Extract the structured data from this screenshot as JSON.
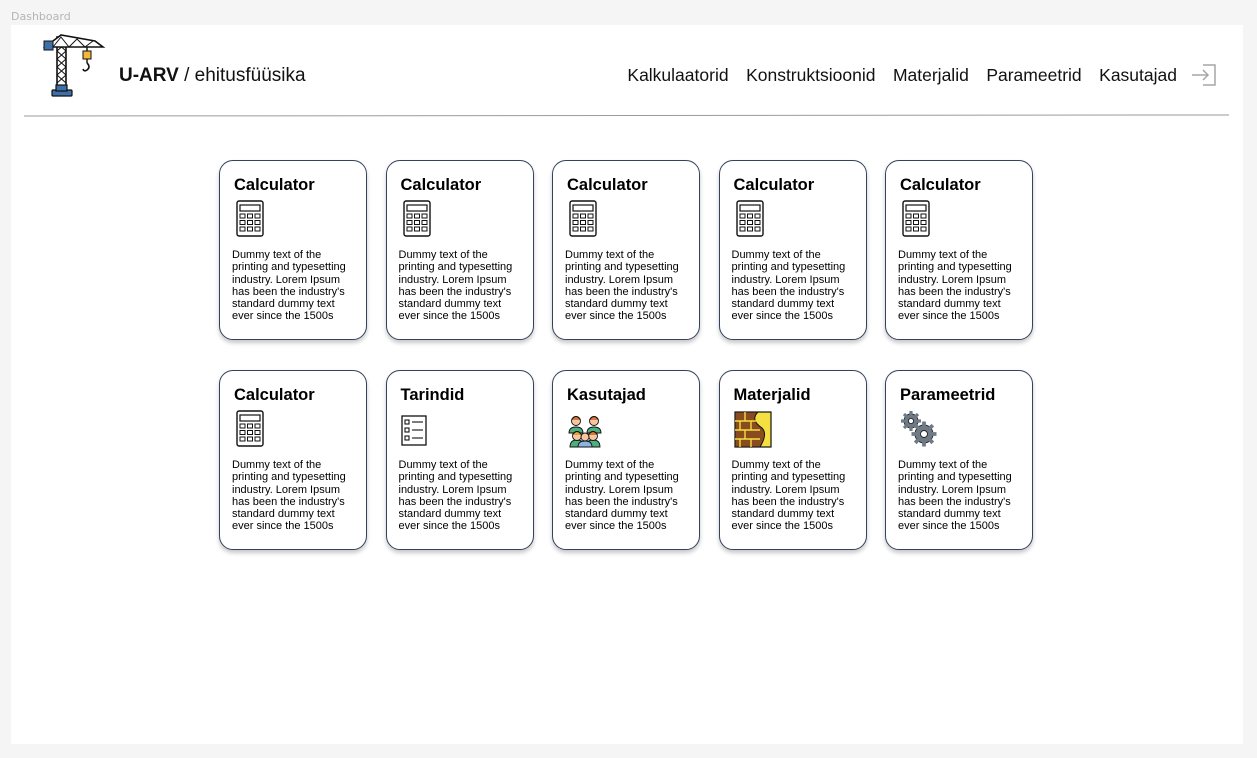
{
  "frame_label": "Dashboard",
  "brand": {
    "name": "U-ARV",
    "subtitle": " / ehitusfüüsika"
  },
  "nav": {
    "items": [
      "Kalkulaatorid",
      "Konstruktsioonid",
      "Materjalid",
      "Parameetrid",
      "Kasutajad"
    ],
    "logout_icon": "logout-icon"
  },
  "colors": {
    "card_border": "#33425d",
    "divider": "#9a9a9a",
    "background": "#f5f5f5"
  },
  "cards": [
    {
      "title": "Calculator",
      "icon": "calculator-icon",
      "desc": "Dummy text of the printing and typesetting industry. Lorem Ipsum has been the industry's standard dummy text ever since the 1500s"
    },
    {
      "title": "Calculator",
      "icon": "calculator-icon",
      "desc": "Dummy text of the printing and typesetting industry. Lorem Ipsum has been the industry's standard dummy text ever since the 1500s"
    },
    {
      "title": "Calculator",
      "icon": "calculator-icon",
      "desc": "Dummy text of the printing and typesetting industry. Lorem Ipsum has been the industry's standard dummy text ever since the 1500s"
    },
    {
      "title": "Calculator",
      "icon": "calculator-icon",
      "desc": "Dummy text of the printing and typesetting industry. Lorem Ipsum has been the industry's standard dummy text ever since the 1500s"
    },
    {
      "title": "Calculator",
      "icon": "calculator-icon",
      "desc": "Dummy text of the printing and typesetting industry. Lorem Ipsum has been the industry's standard dummy text ever since the 1500s"
    },
    {
      "title": "Calculator",
      "icon": "calculator-icon",
      "desc": "Dummy text of the printing and typesetting industry. Lorem Ipsum has been the industry's standard dummy text ever since the 1500s"
    },
    {
      "title": "Tarindid",
      "icon": "checklist-icon",
      "desc": "Dummy text of the printing and typesetting industry. Lorem Ipsum has been the industry's standard dummy text ever since the 1500s"
    },
    {
      "title": "Kasutajad",
      "icon": "users-group-icon",
      "desc": "Dummy text of the printing and typesetting industry. Lorem Ipsum has been the industry's standard dummy text ever since the 1500s"
    },
    {
      "title": "Materjalid",
      "icon": "materials-icon",
      "desc": "Dummy text of the printing and typesetting industry. Lorem Ipsum has been the industry's standard dummy text ever since the 1500s"
    },
    {
      "title": "Parameetrid",
      "icon": "gears-icon",
      "desc": "Dummy text of the printing and typesetting industry. Lorem Ipsum has been the industry's standard dummy text ever since the 1500s"
    }
  ]
}
